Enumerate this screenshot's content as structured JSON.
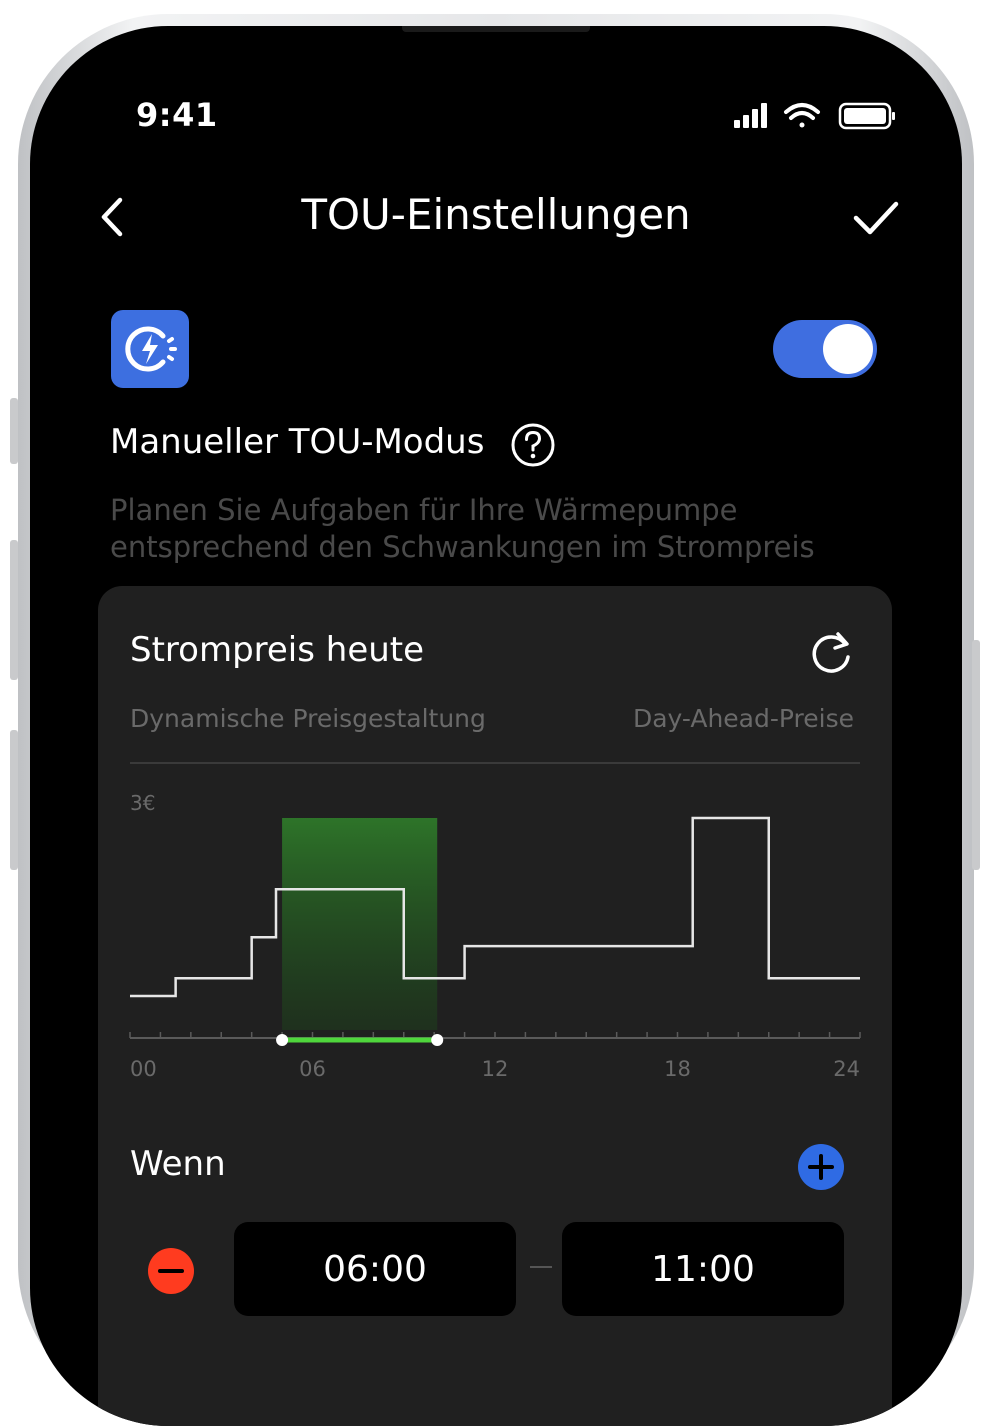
{
  "status_bar": {
    "time": "9:41"
  },
  "header": {
    "title": "TOU-Einstellungen"
  },
  "mode": {
    "title": "Manueller TOU-Modus",
    "description": "Planen Sie Aufgaben für Ihre Wärmepumpe entsprechend den Schwankungen im Strompreis",
    "enabled": true
  },
  "price_card": {
    "title": "Strompreis heute",
    "subtitle_left": "Dynamische Preisgestaltung",
    "subtitle_right": "Day-Ahead-Preise"
  },
  "chart_data": {
    "type": "line",
    "step": true,
    "x": [
      0,
      1.5,
      4,
      4.8,
      9,
      11,
      14.5,
      18.5,
      21,
      24
    ],
    "values": [
      0.0,
      0.1,
      0.33,
      0.6,
      0.1,
      0.28,
      0.28,
      1.0,
      0.1,
      0.1
    ],
    "ylabel": "3€",
    "xlim": [
      0,
      24
    ],
    "x_ticks": [
      "00",
      "06",
      "12",
      "18",
      "24"
    ],
    "highlight_range": [
      5,
      10.1
    ],
    "colors": {
      "line": "#e6e6e6",
      "highlight": "#2f7d2a",
      "selection": "#4fd63c"
    }
  },
  "schedule": {
    "label": "Wenn",
    "start": "06:00",
    "end": "11:00"
  },
  "colors": {
    "accent": "#3f6ee0",
    "danger": "#ff3b1f"
  }
}
